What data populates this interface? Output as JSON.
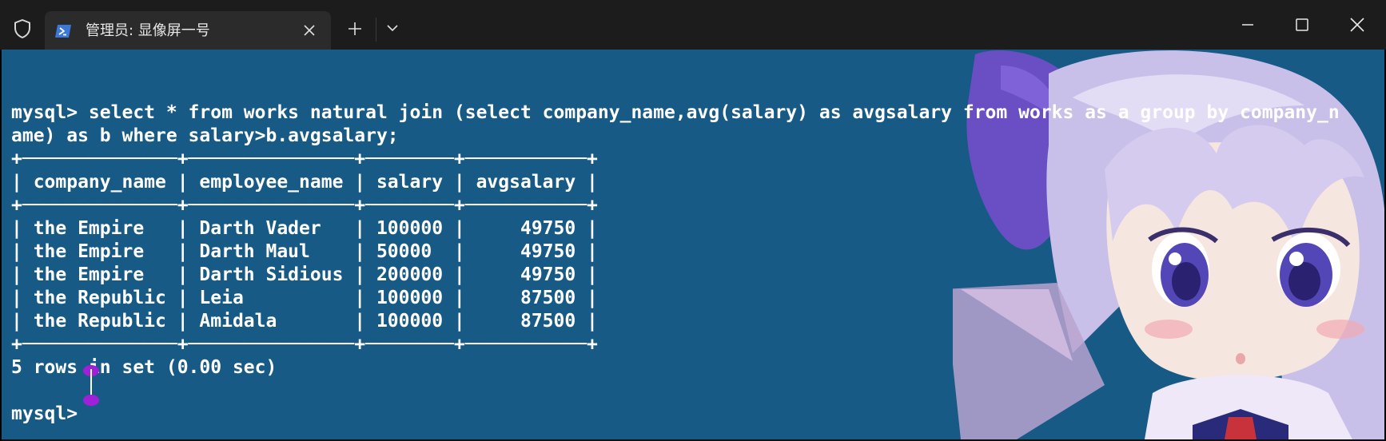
{
  "titlebar": {
    "tab_title": "管理员: 显像屏一号"
  },
  "icons": {
    "shield": "shield-icon",
    "tab": "powershell-icon",
    "tab_close": "close-icon",
    "new_tab": "plus-icon",
    "dropdown": "chevron-down-icon",
    "minimize": "minimize-icon",
    "maximize": "maximize-icon",
    "close": "close-icon"
  },
  "colors": {
    "terminal_background": "#185a86",
    "titlebar_background": "#1c1c1c",
    "tab_background": "#2b2b2b",
    "text": "#ffffff",
    "caret_accent": "#a020d8"
  },
  "terminal": {
    "lines": [
      "",
      "mysql> select * from works natural join (select company_name,avg(salary) as avgsalary from works as a group by company_n",
      "ame) as b where salary>b.avgsalary;",
      "+──────────────+───────────────+────────+───────────+",
      "| company_name | employee_name | salary | avgsalary |",
      "+──────────────+───────────────+────────+───────────+",
      "| the Empire   | Darth Vader   | 100000 |     49750 |",
      "| the Empire   | Darth Maul    | 50000  |     49750 |",
      "| the Empire   | Darth Sidious | 200000 |     49750 |",
      "| the Republic | Leia          | 100000 |     87500 |",
      "| the Republic | Amidala       | 100000 |     87500 |",
      "+──────────────+───────────────+────────+───────────+",
      "5 rows in set (0.00 sec)",
      "",
      "mysql> "
    ]
  }
}
